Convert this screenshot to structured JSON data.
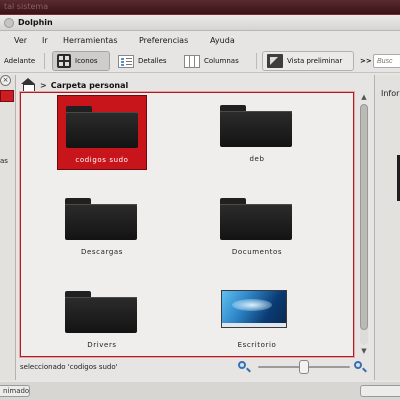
{
  "desktop": {
    "background_title": "tal sistema",
    "bottom_button": "nimados"
  },
  "window": {
    "title": "Dolphin"
  },
  "menu": {
    "items": [
      "Ver",
      "Ir",
      "Herramientas",
      "Preferencias",
      "Ayuda"
    ]
  },
  "toolbar": {
    "forward_label": "Adelante",
    "icons_label": "Iconos",
    "details_label": "Detalles",
    "columns_label": "Columnas",
    "preview_label": "Vista preliminar",
    "overflow_label": ">>",
    "search_placeholder": "Busc"
  },
  "left_panel": {
    "close_glyph": "×",
    "partial_text": "as"
  },
  "breadcrumb": {
    "separator": ">",
    "location": "Carpeta personal"
  },
  "files": [
    {
      "name": "codigos sudo",
      "type": "folder",
      "selected": true
    },
    {
      "name": "deb",
      "type": "folder",
      "selected": false
    },
    {
      "name": "Descargas",
      "type": "folder",
      "selected": false
    },
    {
      "name": "Documentos",
      "type": "folder",
      "selected": false
    },
    {
      "name": "Drivers",
      "type": "folder",
      "selected": false
    },
    {
      "name": "Escritorio",
      "type": "desktop-thumbnail",
      "selected": false
    }
  ],
  "status": {
    "text": "seleccionado 'codigos sudo'",
    "zoom_level_fraction": 0.5
  },
  "right_panel": {
    "title": "Infor"
  },
  "colors": {
    "accent": "#c8141b",
    "selection_border": "#b01c22",
    "window_bg": "#e6e5e3"
  }
}
